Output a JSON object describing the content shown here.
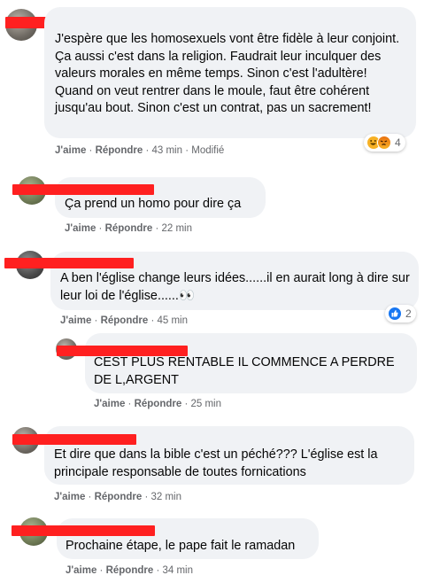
{
  "comments": [
    {
      "text": "J'espère que les homosexuels vont être fidèle à leur conjoint. Ça aussi c'est dans la religion. Faudrait leur inculquer des valeurs morales en même temps. Sinon c'est l'adultère!\nQuand on veut rentrer dans le moule, faut être cohérent jusqu'au bout. Sinon c'est un contrat, pas un sacrement!",
      "like": "J'aime",
      "reply": "Répondre",
      "time": "43 min",
      "edited": "Modifié",
      "reaction_count": "4"
    },
    {
      "text": "Ça prend un homo pour dire ça",
      "like": "J'aime",
      "reply": "Répondre",
      "time": "22 min"
    },
    {
      "text": "A ben l'église change leurs idées......il en aurait long à dire sur leur loi de l'église......",
      "eyes": "👀",
      "like": "J'aime",
      "reply": "Répondre",
      "time": "45 min",
      "reaction_count": "2"
    },
    {
      "text": "CEST PLUS RENTABLE IL COMMENCE A PERDRE DE L,ARGENT",
      "like": "J'aime",
      "reply": "Répondre",
      "time": "25 min"
    },
    {
      "text": "Et dire que dans la bible c'est un péché??? L'église est la principale responsable de toutes fornications",
      "like": "J'aime",
      "reply": "Répondre",
      "time": "32 min"
    },
    {
      "text": "Prochaine étape, le pape fait le ramadan",
      "like": "J'aime",
      "reply": "Répondre",
      "time": "34 min"
    }
  ],
  "colors": {
    "bubble": "#f0f2f5",
    "redaction": "#ff2020",
    "meta": "#65676b",
    "like_blue": "#1877f2"
  },
  "icons": [
    "haha-reaction-icon",
    "angry-reaction-icon",
    "like-reaction-icon"
  ]
}
